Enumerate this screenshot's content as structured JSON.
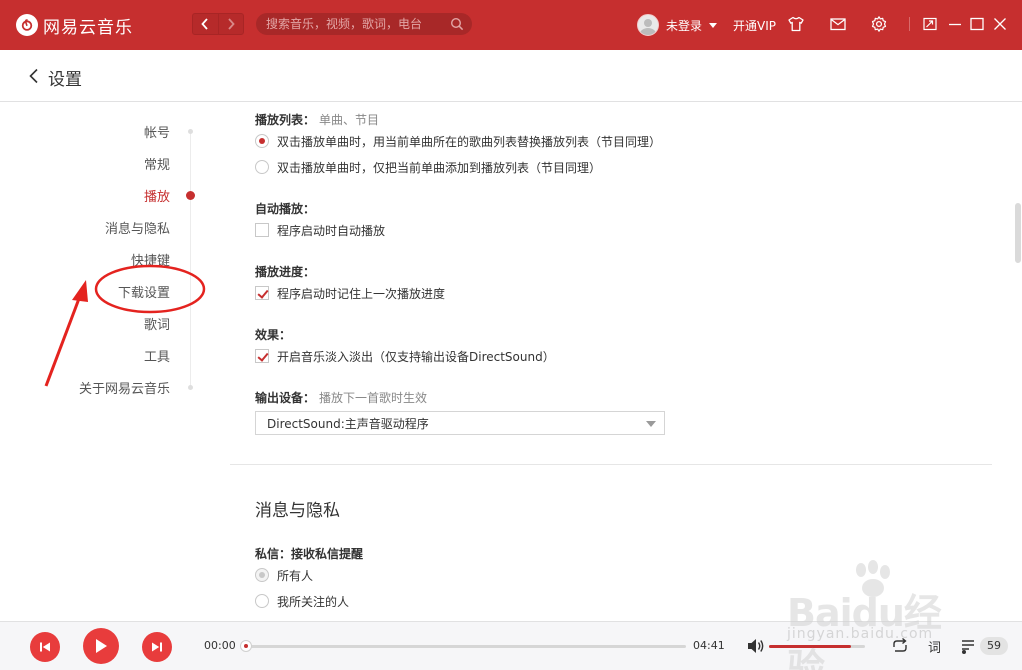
{
  "app": {
    "name": "网易云音乐"
  },
  "titlebar": {
    "search_placeholder": "搜索音乐，视频，歌词，电台",
    "user_name": "未登录",
    "vip_label": "开通VIP"
  },
  "header": {
    "title": "设置"
  },
  "sidenav": {
    "items": [
      {
        "label": "帐号"
      },
      {
        "label": "常规"
      },
      {
        "label": "播放",
        "active": true
      },
      {
        "label": "消息与隐私"
      },
      {
        "label": "快捷键"
      },
      {
        "label": "下载设置"
      },
      {
        "label": "歌词"
      },
      {
        "label": "工具"
      },
      {
        "label": "关于网易云音乐"
      }
    ]
  },
  "play_settings": {
    "playlist_label": "播放列表：",
    "playlist_hint": "单曲、节目",
    "playlist_options": [
      {
        "label": "双击播放单曲时，用当前单曲所在的歌曲列表替换播放列表（节目同理）",
        "selected": true
      },
      {
        "label": "双击播放单曲时，仅把当前单曲添加到播放列表（节目同理）",
        "selected": false
      }
    ],
    "autoplay_label": "自动播放：",
    "autoplay_option": "程序启动时自动播放",
    "autoplay_checked": false,
    "progress_label": "播放进度：",
    "progress_option": "程序启动时记住上一次播放进度",
    "progress_checked": true,
    "effect_label": "效果：",
    "effect_option": "开启音乐淡入淡出（仅支持输出设备DirectSound）",
    "effect_checked": true,
    "output_label": "输出设备：",
    "output_hint": "播放下一首歌时生效",
    "output_value": "DirectSound:主声音驱动程序"
  },
  "privacy": {
    "title": "消息与隐私",
    "dm_label": "私信：",
    "dm_hint": "接收私信提醒",
    "dm_options": [
      {
        "label": "所有人",
        "selected": true
      },
      {
        "label": "我所关注的人",
        "selected": false
      }
    ]
  },
  "player": {
    "current_time": "00:00",
    "total_time": "04:41",
    "progress_fraction": 0,
    "volume_fraction": 0.85,
    "lyric_label": "词",
    "playlist_count": "59"
  },
  "watermark": {
    "main": "Baidu经验",
    "sub": "jingyan.baidu.com"
  },
  "colors": {
    "brand": "#c62f2f",
    "play_button": "#e83c3c"
  }
}
